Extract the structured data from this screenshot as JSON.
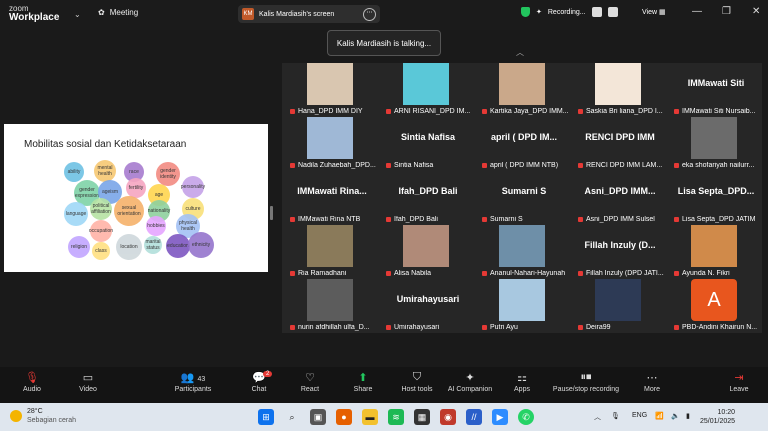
{
  "app": {
    "logo_line1": "zoom",
    "logo_line2": "Workplace",
    "meeting_label": "Meeting"
  },
  "share": {
    "initials": "KM",
    "label": "Kalis Mardiasih's screen"
  },
  "status": {
    "recording": "Recording...",
    "view": "View"
  },
  "talking": "Kalis Mardiasih is talking...",
  "slide": {
    "title": "Mobilitas sosial dan Ketidaksetaraan",
    "words": [
      "ability",
      "mental health",
      "race",
      "gender identity",
      "gender expression",
      "ageism",
      "fertility",
      "age",
      "personality",
      "language",
      "sexual orientation",
      "nationality",
      "culture",
      "political affiliation",
      "hobbies",
      "physical health",
      "occupation",
      "education",
      "religion",
      "class",
      "location",
      "marital status",
      "ethnicity"
    ]
  },
  "tiles": [
    {
      "name": "Hana_DPD IMM DIY",
      "photo": true,
      "color": "#d9c6b0"
    },
    {
      "name": "ARNI RISANI_DPD IM...",
      "photo": true,
      "color": "#5ac8d8"
    },
    {
      "name": "Kartika Jaya_DPD IMM...",
      "photo": true,
      "color": "#caa88a"
    },
    {
      "name": "Saskia Bri liana_DPD I...",
      "photo": true,
      "color": "#f3e6d8"
    },
    {
      "name": "IMMawati Siti Nursaib...",
      "big": "IMMawati  Siti"
    },
    {
      "name": "Nadila Zuhaebah_DPD...",
      "photo": true,
      "color": "#9fb8d6"
    },
    {
      "name": "Sintia Nafisa",
      "big": "Sintia Nafisa"
    },
    {
      "name": "april ( DPD IMM NTB)",
      "big": "april  ( DPD IM..."
    },
    {
      "name": "RENCI DPD IMM LAM...",
      "big": "RENCI  DPD  IMM"
    },
    {
      "name": "eka shofariyah nailurr...",
      "photo": true,
      "color": "#6b6b6b"
    },
    {
      "name": "IMMawati Rina NTB",
      "big": "IMMawati  Rina..."
    },
    {
      "name": "Ifah_DPD Bali",
      "big": "Ifah_DPD Bali"
    },
    {
      "name": "Sumarni S",
      "big": "Sumarni S"
    },
    {
      "name": "Asni_DPD IMM Sulsel",
      "big": "Asni_DPD  IMM..."
    },
    {
      "name": "Lisa Septa_DPD JATIM",
      "big": "Lisa  Septa_DPD..."
    },
    {
      "name": "Ria Ramadhani",
      "photo": true,
      "color": "#8a7a5a"
    },
    {
      "name": "Alisa Nabila",
      "photo": true,
      "color": "#b08a78"
    },
    {
      "name": "Ananul-Nahari-Hayunah",
      "photo": true,
      "color": "#6e8fa8"
    },
    {
      "name": "Fillah Inzuly (DPD JATI...",
      "big": "Fillah  Inzuly  (D..."
    },
    {
      "name": "Ayunda N. Fikri",
      "photo": true,
      "color": "#d08a4a"
    },
    {
      "name": "nurin afdhillah ulfa_D...",
      "photo": true,
      "color": "#5c5c5c"
    },
    {
      "name": "Umirahayusari",
      "big": "Umirahayusari"
    },
    {
      "name": "Putri Ayu",
      "photo": true,
      "color": "#a8c8e0"
    },
    {
      "name": "Deira99",
      "photo": true,
      "color": "#2d3a55"
    },
    {
      "name": "PBD-Andini Khairun N...",
      "avatar": "A",
      "color": "#e8561e"
    }
  ],
  "toolbar": {
    "audio": "Audio",
    "video": "Video",
    "participants": "Participants",
    "participant_count": "43",
    "chat": "Chat",
    "chat_badge": "2",
    "react": "React",
    "share": "Share",
    "host_tools": "Host tools",
    "ai_companion": "AI Companion",
    "apps": "Apps",
    "pause_stop": "Pause/stop recording",
    "more": "More",
    "leave": "Leave"
  },
  "taskbar": {
    "temperature": "28°C",
    "weather": "Sebagian cerah",
    "lang": "ENG",
    "time": "10:20",
    "date": "25/01/2025"
  },
  "colors": {
    "accent": "#0e72ed",
    "mute": "#e53935",
    "bg": "#1a1a1a"
  }
}
